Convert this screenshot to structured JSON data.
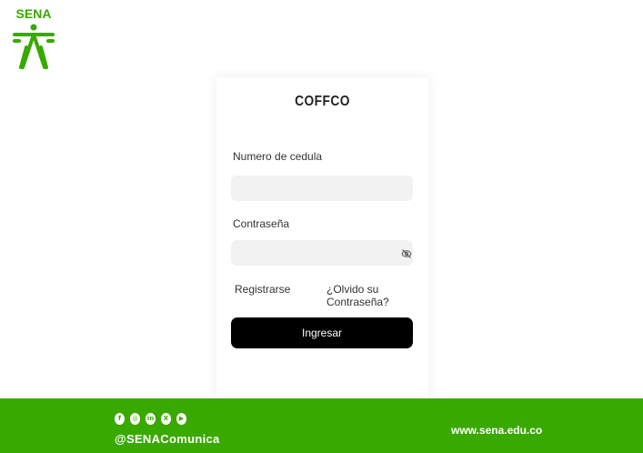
{
  "brand": {
    "logo_text": "SENA",
    "color": "#39a900"
  },
  "login": {
    "title": "COFFCO",
    "cedula_label": "Numero de cedula",
    "cedula_value": "",
    "password_label": "Contraseña",
    "password_value": "",
    "register_link": "Registrarse",
    "forgot_link": "¿Olvido su Contraseña?",
    "submit_label": "Ingresar",
    "password_toggle_icon": "eye-off-icon"
  },
  "footer": {
    "background": "#39a900",
    "socials": [
      {
        "icon": "facebook-icon",
        "glyph": "f"
      },
      {
        "icon": "instagram-icon",
        "glyph": "◎"
      },
      {
        "icon": "linkedin-icon",
        "glyph": "in"
      },
      {
        "icon": "x-icon",
        "glyph": "X"
      },
      {
        "icon": "youtube-icon",
        "glyph": "▶"
      }
    ],
    "handle": "@SENAComunica",
    "website": "www.sena.edu.co"
  }
}
